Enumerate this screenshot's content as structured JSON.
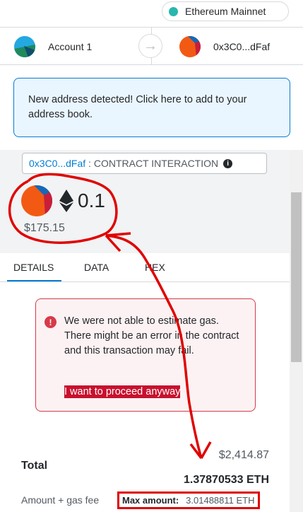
{
  "network": {
    "label": "Ethereum Mainnet",
    "dot_color": "#29b6af"
  },
  "sender": {
    "name": "Account 1"
  },
  "recipient": {
    "address": "0x3C0...dFaf"
  },
  "notice": {
    "text": "New address detected! Click here to add to your address book."
  },
  "summary": {
    "origin_address": "0x3C0...dFaf",
    "origin_sep": " : ",
    "origin_method": "CONTRACT INTERACTION",
    "eth_amount": "0.1",
    "fiat_amount": "$175.15"
  },
  "tabs": [
    {
      "label": "DETAILS",
      "active": true
    },
    {
      "label": "DATA"
    },
    {
      "label": "HEX"
    }
  ],
  "error": {
    "message": "We were not able to estimate gas. There might be an error in the contract and this transaction may fail.",
    "proceed_link": "I want to proceed anyway"
  },
  "totals": {
    "label": "Total",
    "fiat": "$2,414.87",
    "eth": "1.37870533 ETH",
    "fee_label": "Amount + gas fee",
    "max_label": "Max amount:",
    "max_value": "3.01488811 ETH"
  },
  "colors": {
    "accent": "#037dd6",
    "error": "#d73a49",
    "annotation": "#e00000"
  }
}
